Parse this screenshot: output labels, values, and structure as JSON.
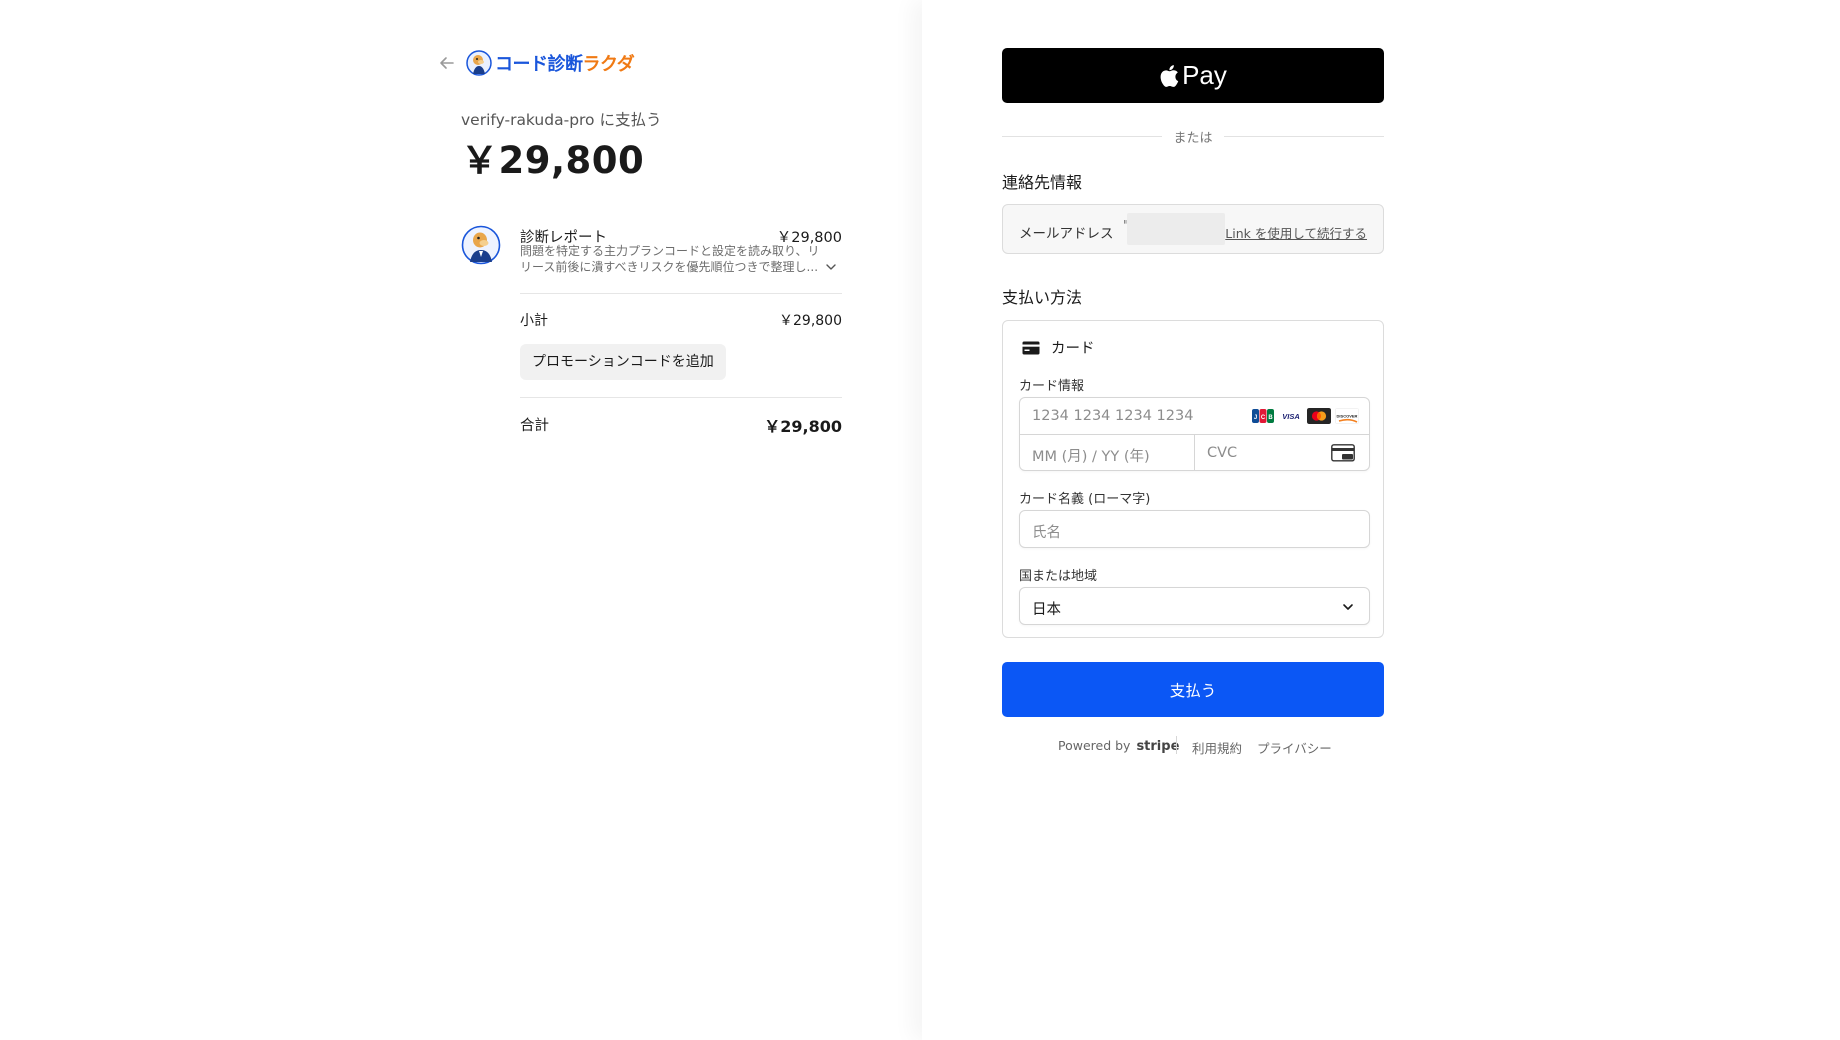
{
  "header": {
    "back_icon": "arrow-left-icon",
    "brand_part1": "コード診断",
    "brand_part2": "ラクダ",
    "brand_color1": "#1a56db",
    "brand_color2": "#f07a14"
  },
  "summary": {
    "pay_to": "verify-rakuda-pro に支払う",
    "amount": "￥29,800"
  },
  "line_item": {
    "name": "診断レポート",
    "price": "￥29,800",
    "description": "問題を特定する主力プランコードと設定を読み取り、リリース前後に潰すべきリスクを優先順位つきで整理し..."
  },
  "totals": {
    "subtotal_label": "小計",
    "subtotal_value": "￥29,800",
    "promo_label": "プロモーションコードを追加",
    "total_label": "合計",
    "total_value": "￥29,800"
  },
  "payment": {
    "apple_pay_label": "Pay",
    "or_label": "または",
    "contact_title": "連絡先情報",
    "email_label": "メールアドレス",
    "email_prefix": "\"",
    "link_label": "Link を使用して続行する",
    "method_title": "支払い方法",
    "card_tab_label": "カード",
    "card_info_label": "カード情報",
    "card_number_placeholder": "1234 1234 1234 1234",
    "expiry_placeholder": "MM (月) / YY (年)",
    "cvc_placeholder": "CVC",
    "card_brands": [
      "JCB",
      "VISA",
      "Mastercard",
      "DISCOVER"
    ],
    "cardholder_label": "カード名義 (ローマ字)",
    "cardholder_placeholder": "氏名",
    "country_label": "国または地域",
    "country_value": "日本",
    "pay_button": "支払う",
    "accent_color": "#0b57f5"
  },
  "footer": {
    "powered_by": "Powered by",
    "stripe": "stripe",
    "terms": "利用規約",
    "privacy": "プライバシー"
  }
}
